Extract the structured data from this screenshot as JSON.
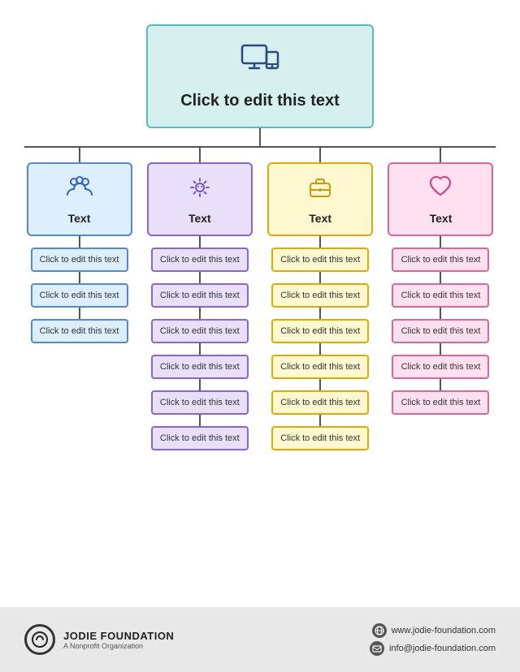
{
  "root": {
    "title": "Click to edit this text",
    "icon": "computer"
  },
  "columns": [
    {
      "id": "blue",
      "color": "blue",
      "icon": "people",
      "label": "Text",
      "children": [
        "Click to edit this text",
        "Click to edit this text",
        "Click to edit this text"
      ]
    },
    {
      "id": "purple",
      "color": "purple",
      "icon": "settings",
      "label": "Text",
      "children": [
        "Click to edit this text",
        "Click to edit this text",
        "Click to edit this text",
        "Click to edit this text",
        "Click to edit this text",
        "Click to edit this text"
      ]
    },
    {
      "id": "yellow",
      "color": "yellow",
      "icon": "briefcase",
      "label": "Text",
      "children": [
        "Click to edit this text",
        "Click to edit this text",
        "Click to edit this text",
        "Click to edit this text",
        "Click to edit this text",
        "Click to edit this text"
      ]
    },
    {
      "id": "pink",
      "color": "pink",
      "icon": "heart",
      "label": "Text",
      "children": [
        "Click to edit this text",
        "Click to edit this text",
        "Click to edit this text",
        "Click to edit this text",
        "Click to edit this text"
      ]
    }
  ],
  "footer": {
    "org_name": "JODIE FOUNDATION",
    "org_sub": "A Nonprofit Organization",
    "website": "www.jodie-foundation.com",
    "email": "info@jodie-foundation.com"
  }
}
